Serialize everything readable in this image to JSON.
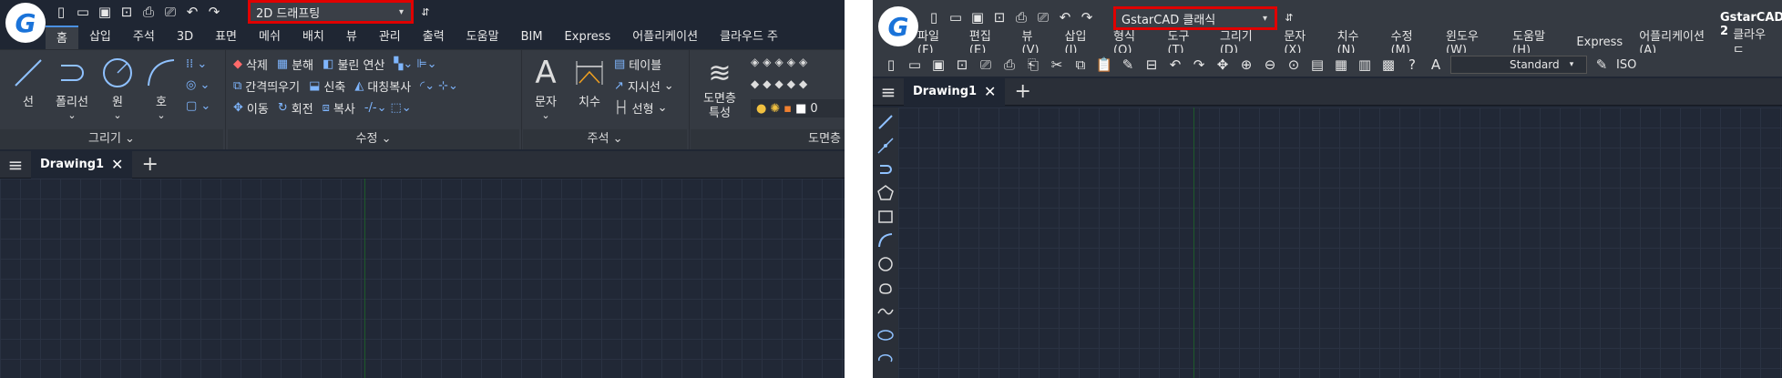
{
  "left": {
    "workspace": "2D 드래프팅",
    "tabs": [
      "홈",
      "삽입",
      "주석",
      "3D",
      "표면",
      "메쉬",
      "배치",
      "뷰",
      "관리",
      "출력",
      "도움말",
      "BIM",
      "Express",
      "어플리케이션",
      "클라우드 주"
    ],
    "draw": {
      "buttons": [
        "선",
        "폴리선",
        "원",
        "호"
      ],
      "title": "그리기"
    },
    "modify": {
      "rows": [
        [
          "삭제",
          "분해",
          "불린 연산"
        ],
        [
          "간격띄우기",
          "신축",
          "대칭복사"
        ],
        [
          "이동",
          "회전",
          "복사"
        ]
      ],
      "title": "수정"
    },
    "annotation": {
      "text": "문자",
      "dim": "치수",
      "table": "테이블",
      "leader": "지시선",
      "linear": "선형",
      "title": "주석"
    },
    "layer": {
      "props": "도면층\n특성",
      "value": "0",
      "title": "도면층"
    },
    "doc_tab": "Drawing1"
  },
  "right": {
    "workspace": "GstarCAD 클래식",
    "app_title": "GstarCAD 2",
    "menu": [
      "파일(F)",
      "편집(E)",
      "뷰(V)",
      "삽입(I)",
      "형식(O)",
      "도구(T)",
      "그리기(D)",
      "문자(X)",
      "치수(N)",
      "수정(M)",
      "윈도우(W)",
      "도움말(H)",
      "Express",
      "어플리케이션(A)",
      "클라우드"
    ],
    "style": "Standard",
    "iso": "ISO",
    "doc_tab": "Drawing1"
  },
  "colors": {
    "highlight": "#e00000",
    "accent": "#4a90e2",
    "canvas": "#212836"
  }
}
